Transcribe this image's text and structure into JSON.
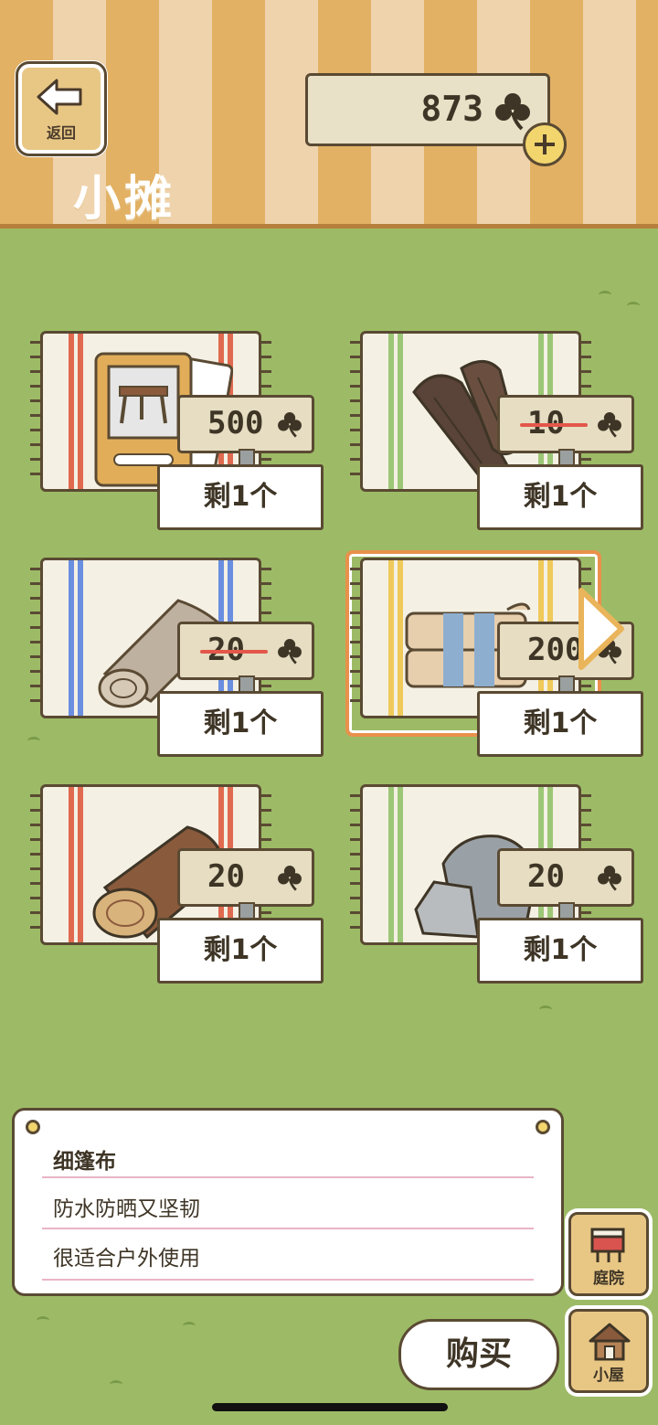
{
  "header": {
    "back_label": "返回",
    "title": "小摊",
    "currency_value": "873",
    "currency_icon": "clover-icon",
    "plus_icon": "plus-icon"
  },
  "items": [
    {
      "name": "table-card",
      "price": "500",
      "discounted": false,
      "stock": "剩1个",
      "stripe_color": "#e06a4f",
      "art": "card"
    },
    {
      "name": "driftwood",
      "price": "10",
      "discounted": true,
      "stock": "剩1个",
      "stripe_color": "#9cc776",
      "art": "wood"
    },
    {
      "name": "cloth-roll",
      "price": "20",
      "discounted": true,
      "stock": "剩1个",
      "stripe_color": "#6a8ee0",
      "art": "roll"
    },
    {
      "name": "tent-cloth",
      "price": "200",
      "discounted": false,
      "stock": "剩1个",
      "stripe_color": "#efc95a",
      "art": "folded",
      "selected": true
    },
    {
      "name": "log",
      "price": "20",
      "discounted": false,
      "stock": "剩1个",
      "stripe_color": "#e06a4f",
      "art": "log"
    },
    {
      "name": "stone",
      "price": "20",
      "discounted": false,
      "stock": "剩1个",
      "stripe_color": "#9cc776",
      "art": "stone"
    }
  ],
  "description": {
    "name": "细篷布",
    "line1": "防水防晒又坚韧",
    "line2": "很适合户外使用"
  },
  "buttons": {
    "buy_label": "购买",
    "yard_label": "庭院",
    "house_label": "小屋"
  },
  "colors": {
    "grass": "#9dbb66",
    "header_stripe_dark": "#e2b164",
    "header_stripe_light": "#efd3ad",
    "selection": "#e9914c"
  }
}
